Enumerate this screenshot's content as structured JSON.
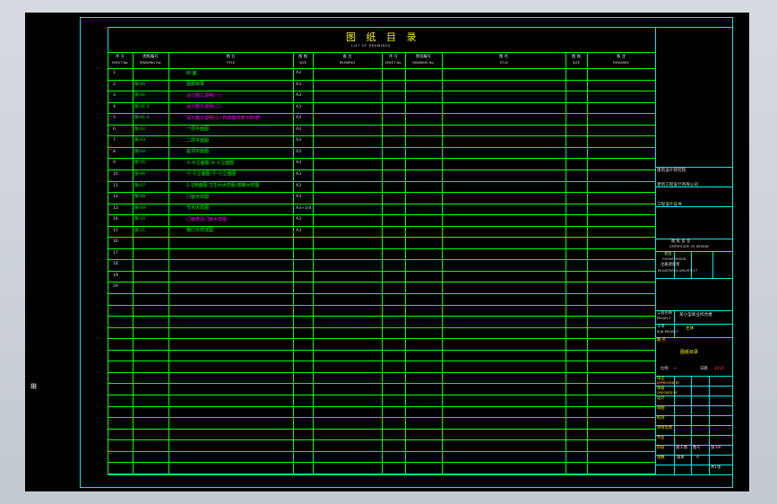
{
  "title": {
    "main": "图 纸 目 录",
    "sub": "LIST OF DRAWINGS"
  },
  "table": {
    "headers": {
      "left": {
        "no_cn": "序 号",
        "no_en": "SHEET No.",
        "code_cn": "图纸编号",
        "code_en": "DRAWING No.",
        "name_cn": "图 名",
        "name_en": "TITLE",
        "size_cn": "图 幅",
        "size_en": "SIZE",
        "remark_cn": "备 注",
        "remark_en": "REMARKS"
      },
      "right": {
        "no_cn": "序 号",
        "no_en": "SHEET No.",
        "code_cn": "图纸编号",
        "code_en": "DRAWING No.",
        "name_cn": "图 名",
        "name_en": "TITLE",
        "size_cn": "图 幅",
        "size_en": "SIZE",
        "remark_cn": "备 注",
        "remark_en": "REMARKS"
      }
    },
    "rows": [
      {
        "no": "1",
        "code": "",
        "name": "封 面",
        "name_color": "green",
        "size": "A3",
        "remark": ""
      },
      {
        "no": "2",
        "code": "施-00",
        "name": "图纸目录",
        "name_color": "green",
        "size": "A3",
        "remark": ""
      },
      {
        "no": "3",
        "code": "施-01",
        "name": "设计施工说明(一)",
        "name_color": "magenta",
        "size": "A3",
        "remark": ""
      },
      {
        "no": "4",
        "code": "施-01-1",
        "name": "设计施工说明(二)",
        "name_color": "magenta",
        "size": "A3",
        "remark": ""
      },
      {
        "no": "5",
        "code": "施-01-2",
        "name": "设计施工说明(三) 构造做法表 材料表",
        "name_color": "magenta",
        "size": "A3",
        "remark": ""
      },
      {
        "no": "6",
        "code": "施-02",
        "name": "一层平面图",
        "name_color": "green",
        "size": "A3",
        "remark": ""
      },
      {
        "no": "7",
        "code": "施-03",
        "name": "二层平面图",
        "name_color": "green",
        "size": "A3",
        "remark": ""
      },
      {
        "no": "8",
        "code": "施-04",
        "name": "屋顶平面图",
        "name_color": "green",
        "size": "A3",
        "remark": ""
      },
      {
        "no": "9",
        "code": "施-05",
        "name": "①-⑥立面图  ⑥-①立面图",
        "name_color": "green",
        "size": "A3",
        "remark": ""
      },
      {
        "no": "10",
        "code": "施-06",
        "name": "Ⓐ-Ⓓ立面图  Ⓓ-Ⓐ立面图",
        "name_color": "green",
        "size": "A3",
        "remark": ""
      },
      {
        "no": "11",
        "code": "施-07",
        "name": "1-1剖面图  卫生间大样图  楼梯大样图",
        "name_color": "green",
        "size": "A3",
        "remark": ""
      },
      {
        "no": "12",
        "code": "施-08",
        "name": "门窗大样图",
        "name_color": "green",
        "size": "A3",
        "remark": ""
      },
      {
        "no": "13",
        "code": "施-09",
        "name": "节点大样图",
        "name_color": "green",
        "size": "A3+1/4",
        "remark": ""
      },
      {
        "no": "14",
        "code": "施-10",
        "name": "门窗表及门窗大样图",
        "name_color": "magenta",
        "size": "A3",
        "remark": ""
      },
      {
        "no": "15",
        "code": "施-11",
        "name": "檐口大样详图",
        "name_color": "green",
        "size": "A3",
        "remark": ""
      },
      {
        "no": "16",
        "code": "",
        "name": "",
        "name_color": "green",
        "size": "",
        "remark": ""
      },
      {
        "no": "17",
        "code": "",
        "name": "",
        "name_color": "green",
        "size": "",
        "remark": ""
      },
      {
        "no": "18",
        "code": "",
        "name": "",
        "name_color": "green",
        "size": "",
        "remark": ""
      },
      {
        "no": "19",
        "code": "",
        "name": "",
        "name_color": "green",
        "size": "",
        "remark": ""
      },
      {
        "no": "20",
        "code": "",
        "name": "",
        "name_color": "green",
        "size": "",
        "remark": ""
      }
    ]
  },
  "titleblock": {
    "company1": "建筑设计研究院",
    "company2": "建筑工程设计有限公司",
    "cert": "工程设计证书",
    "seal_title": "图 纸 会 签",
    "seal_sub": "CERTIFICATE OF DESIGN",
    "cosign1": "会签",
    "cosign2": "COUNTERSIGN",
    "cosign3": "注册建筑师",
    "cosign4": "REGISTERED ARCHITECT",
    "project_label": "工程名称",
    "project_en": "PROJECT",
    "project_value": "某小型商业综合楼",
    "item_label": "子项",
    "item_en": "SUB-PROJECT",
    "item_value": "主体",
    "drawing_label": "图 名",
    "drawing_value": "图纸目录",
    "scale_label": "比例",
    "scale_value": "—",
    "date_label": "日期",
    "date_value": "2019",
    "approved": "审定",
    "approved_en": "APPROVED BY",
    "checked": "审核",
    "checked_en": "CHECKED BY",
    "designer": "设计",
    "drawn": "制图",
    "revised": "校对",
    "project_mgr": "项目负责",
    "discipline": "专业",
    "stage": "阶段",
    "stage_value": "施工图",
    "sheet": "图号",
    "sheet_value": "施-00",
    "total": "张数",
    "version": "版本",
    "version_value": "A",
    "page": "共1张"
  },
  "marker": "⊞"
}
